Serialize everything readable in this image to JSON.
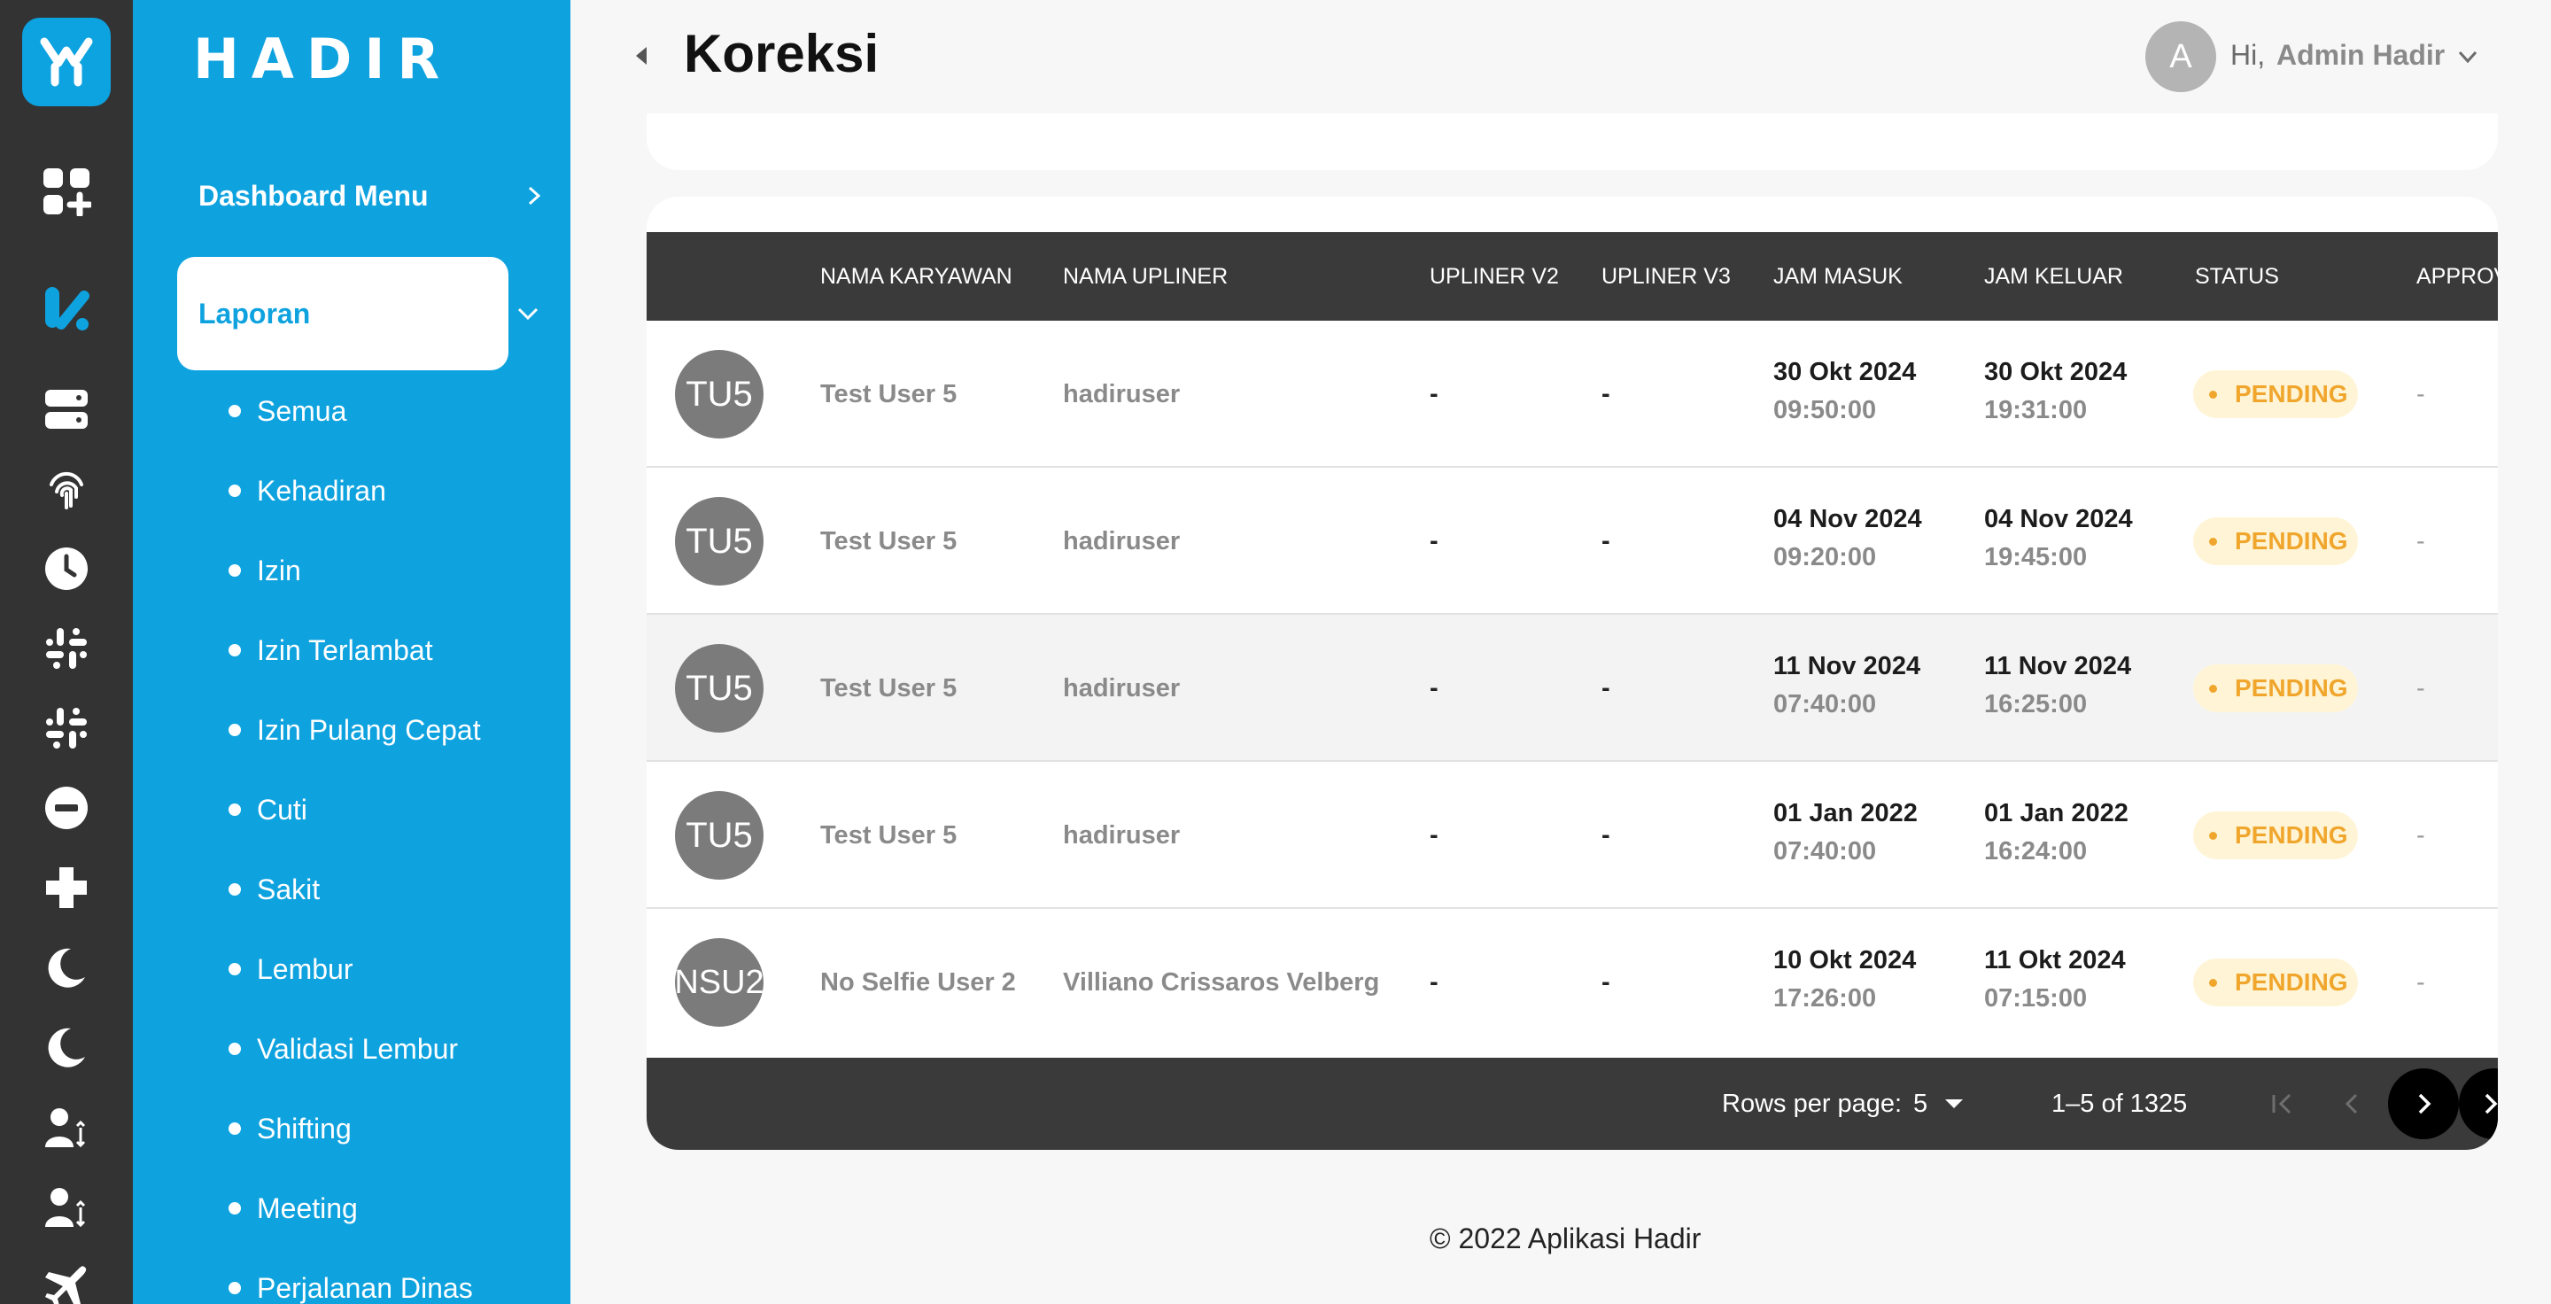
{
  "app": {
    "brand": "HADIR"
  },
  "header": {
    "title": "Koreksi",
    "avatar_letter": "A",
    "greeting": "Hi,",
    "user_name": "Admin Hadir"
  },
  "sidebar": {
    "dashboard_label": "Dashboard Menu",
    "laporan_label": "Laporan",
    "sub_items": [
      "Semua",
      "Kehadiran",
      "Izin",
      "Izin Terlambat",
      "Izin Pulang Cepat",
      "Cuti",
      "Sakit",
      "Lembur",
      "Validasi Lembur",
      "Shifting",
      "Meeting",
      "Perjalanan Dinas"
    ]
  },
  "rail_icons": [
    "app-logo-icon",
    "dashboard-grid-icon",
    "report-icon",
    "server-icon",
    "fingerprint-icon",
    "clock-icon",
    "slack-icon",
    "slack-icon",
    "minus-circle-icon",
    "plus-cross-icon",
    "moon-icon",
    "moon-icon",
    "user-transfer-icon",
    "user-transfer-icon",
    "airplane-icon"
  ],
  "table": {
    "columns": [
      "NAMA KARYAWAN",
      "NAMA UPLINER",
      "UPLINER V2",
      "UPLINER V3",
      "JAM MASUK",
      "JAM KELUAR",
      "STATUS",
      "APPROV"
    ],
    "rows": [
      {
        "avatar": "TU5",
        "nama": "Test User 5",
        "upliner": "hadiruser",
        "v2": "-",
        "v3": "-",
        "masuk_date": "30 Okt 2024",
        "masuk_time": "09:50:00",
        "keluar_date": "30 Okt 2024",
        "keluar_time": "19:31:00",
        "status": "PENDING",
        "approv": "-"
      },
      {
        "avatar": "TU5",
        "nama": "Test User 5",
        "upliner": "hadiruser",
        "v2": "-",
        "v3": "-",
        "masuk_date": "04 Nov 2024",
        "masuk_time": "09:20:00",
        "keluar_date": "04 Nov 2024",
        "keluar_time": "19:45:00",
        "status": "PENDING",
        "approv": "-"
      },
      {
        "avatar": "TU5",
        "nama": "Test User 5",
        "upliner": "hadiruser",
        "v2": "-",
        "v3": "-",
        "masuk_date": "11 Nov 2024",
        "masuk_time": "07:40:00",
        "keluar_date": "11 Nov 2024",
        "keluar_time": "16:25:00",
        "status": "PENDING",
        "approv": "-"
      },
      {
        "avatar": "TU5",
        "nama": "Test User 5",
        "upliner": "hadiruser",
        "v2": "-",
        "v3": "-",
        "masuk_date": "01 Jan 2022",
        "masuk_time": "07:40:00",
        "keluar_date": "01 Jan 2022",
        "keluar_time": "16:24:00",
        "status": "PENDING",
        "approv": "-"
      },
      {
        "avatar": "NSU2",
        "nama": "No Selfie User 2",
        "upliner": "Villiano Crissaros Velberg",
        "v2": "-",
        "v3": "-",
        "masuk_date": "10 Okt 2024",
        "masuk_time": "17:26:00",
        "keluar_date": "11 Okt 2024",
        "keluar_time": "07:15:00",
        "status": "PENDING",
        "approv": "-"
      }
    ]
  },
  "pagination": {
    "rows_per_page_label": "Rows per page:",
    "rows_per_page": "5",
    "range": "1–5 of 1325"
  },
  "footer": {
    "copyright": "© 2022 Aplikasi Hadir"
  },
  "colors": {
    "rail": "#333333",
    "sidebar": "#0ea2df",
    "table_header": "#3a3a3a",
    "pending": "#f0a62d"
  }
}
